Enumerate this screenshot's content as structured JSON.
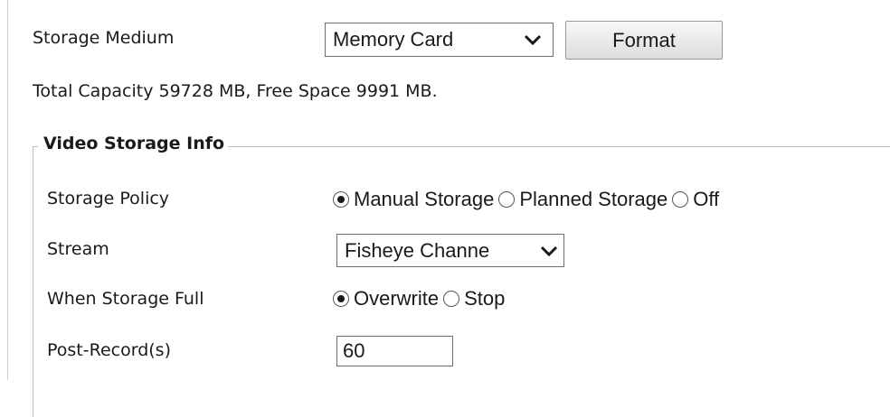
{
  "storage": {
    "medium_label": "Storage Medium",
    "medium_value": "Memory Card",
    "format_label": "Format",
    "capacity_text": "Total Capacity 59728 MB, Free Space 9991 MB."
  },
  "video_storage": {
    "legend": "Video Storage Info",
    "policy": {
      "label": "Storage Policy",
      "options": [
        "Manual Storage",
        "Planned Storage",
        "Off"
      ],
      "selected": "Manual Storage"
    },
    "stream": {
      "label": "Stream",
      "value": "Fisheye Channe"
    },
    "when_full": {
      "label": "When Storage Full",
      "options": [
        "Overwrite",
        "Stop"
      ],
      "selected": "Overwrite"
    },
    "post_record": {
      "label": "Post-Record(s)",
      "value": "60"
    }
  },
  "icons": {
    "dropdown": "chevron-down-icon",
    "radio_selected": "radio-selected-icon",
    "radio_unselected": "radio-unselected-icon"
  }
}
